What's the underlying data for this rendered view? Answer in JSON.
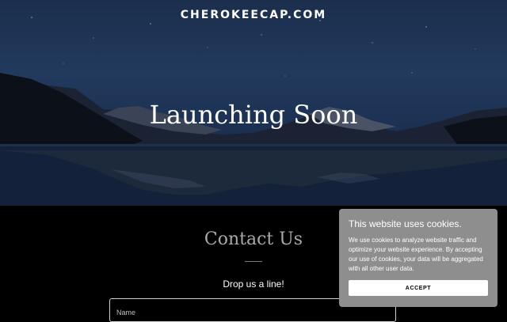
{
  "header": {
    "site_name": "CHEROKEECAP.COM"
  },
  "hero": {
    "title": "Launching Soon"
  },
  "contact": {
    "title": "Contact Us",
    "subtitle": "Drop us a line!",
    "name_placeholder": "Name"
  },
  "cookie_banner": {
    "title": "This website uses cookies.",
    "text": "We use cookies to analyze website traffic and optimize your website experience. By accepting our use of cookies, your data will be aggregated with all other user data.",
    "accept_label": "ACCEPT"
  },
  "colors": {
    "sky_top": "#1b2e4c",
    "contact_bg": "#000000",
    "cookie_bg": "#8e8e8e",
    "contact_title": "#a9a9a9"
  }
}
